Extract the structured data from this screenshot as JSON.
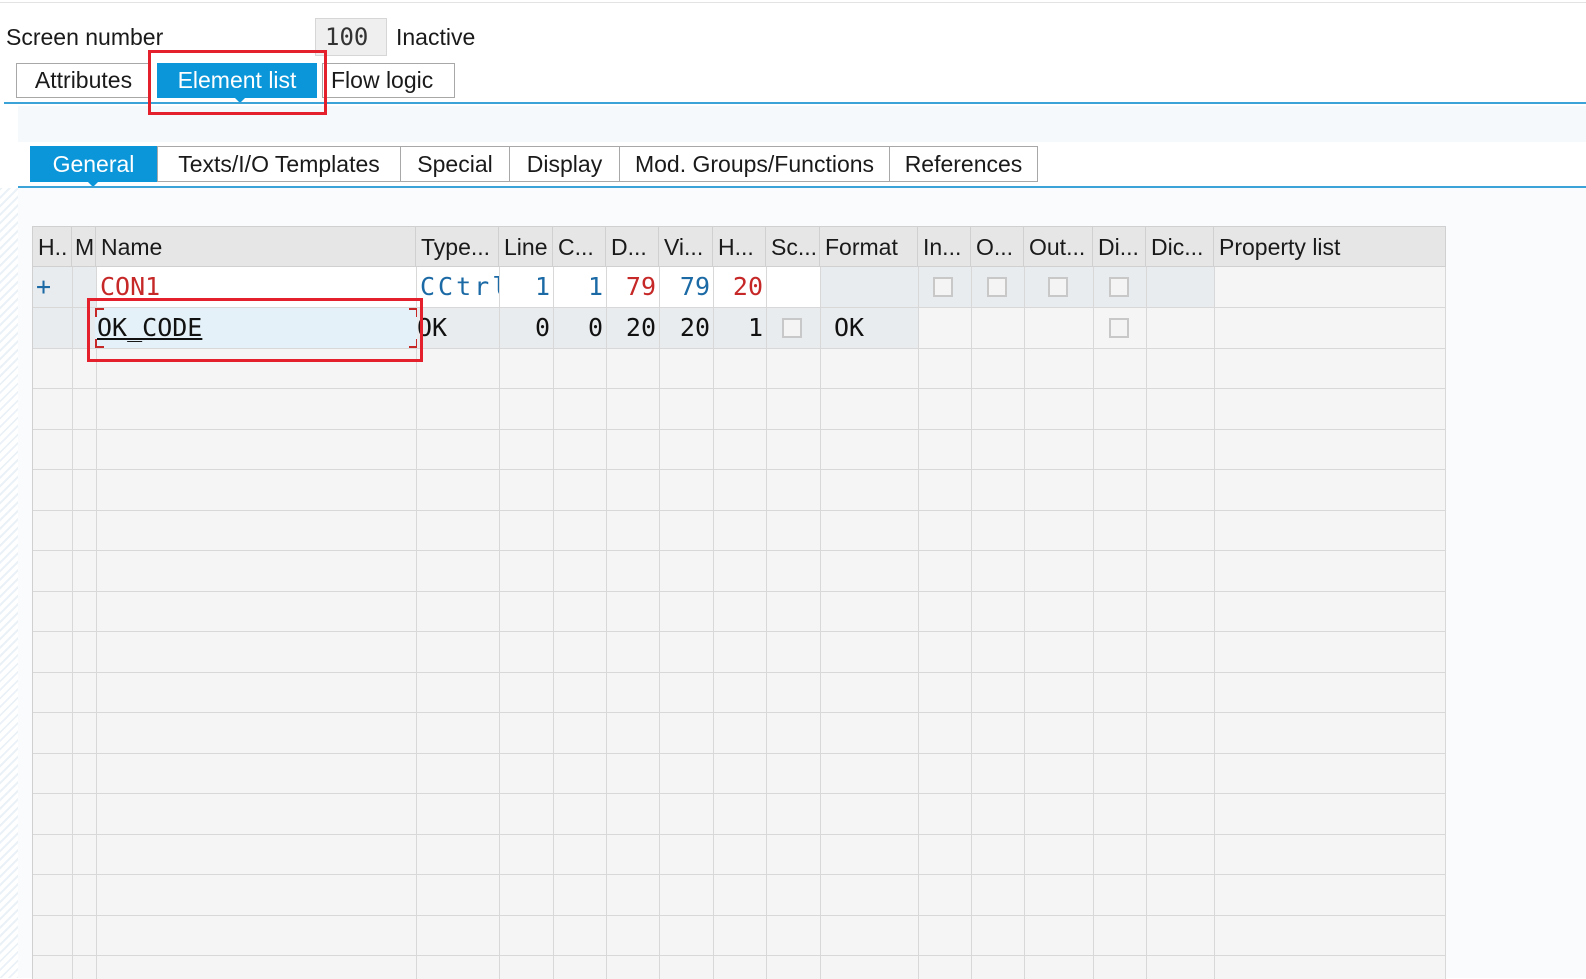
{
  "screen": {
    "label": "Screen number",
    "number": "100",
    "status": "Inactive"
  },
  "main_tabs": [
    {
      "label": "Attributes",
      "active": false
    },
    {
      "label": "Element list",
      "active": true
    },
    {
      "label": "Flow logic",
      "active": false
    }
  ],
  "sub_tabs": [
    {
      "label": "General",
      "active": true
    },
    {
      "label": "Texts/I/O Templates",
      "active": false
    },
    {
      "label": "Special",
      "active": false
    },
    {
      "label": "Display",
      "active": false
    },
    {
      "label": "Mod. Groups/Functions",
      "active": false
    },
    {
      "label": "References",
      "active": false
    }
  ],
  "table": {
    "headers": [
      "H..",
      "M",
      "Name",
      "Type...",
      "Line",
      "C...",
      "D...",
      "Vi...",
      "H...",
      "Sc...",
      "Format",
      "In...",
      "O...",
      "Out...",
      "Di...",
      "Dic...",
      "Property list"
    ],
    "rows": [
      {
        "h": "+",
        "m": "",
        "name": "CON1",
        "type": "CCtrl",
        "line": "1",
        "col": "1",
        "deflen": "79",
        "vislen": "79",
        "height": "20",
        "format": ""
      },
      {
        "h": "",
        "m": "",
        "name": "OK_CODE",
        "type": "OK",
        "line": "0",
        "col": "0",
        "deflen": "20",
        "vislen": "20",
        "height": "1",
        "format": "OK"
      }
    ]
  },
  "colors": {
    "accent": "#0a96d9",
    "highlight": "#e3202c",
    "value_blue": "#1b6aa5",
    "value_red": "#c62828"
  }
}
